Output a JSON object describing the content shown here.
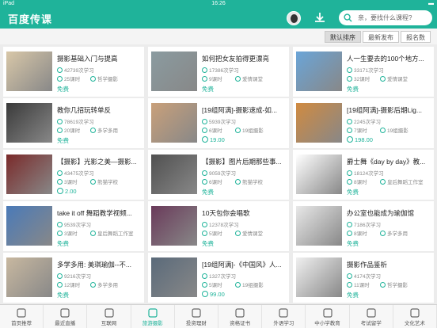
{
  "status": {
    "device": "iPad",
    "time": "16:26"
  },
  "header": {
    "logo": "百度传课",
    "search_placeholder": "亲，要找什么课程?"
  },
  "sort": [
    "默认排序",
    "最新发布",
    "报名数"
  ],
  "courses": [
    {
      "title": "摄影基础入门与提高",
      "students": "42739次学习",
      "lessons": "25课时",
      "category": "哲学摄影",
      "price": "免费",
      "paid": false
    },
    {
      "title": "如何把女友拍得更漂亮",
      "students": "17386次学习",
      "lessons": "9课时",
      "category": "爱情课堂",
      "price": "免费",
      "paid": false
    },
    {
      "title": "人一生要去的100个地方...",
      "students": "33171次学习",
      "lessons": "32课时",
      "category": "爱情课堂",
      "price": "免费",
      "paid": false
    },
    {
      "title": "教你几招玩转单反",
      "students": "78619次学习",
      "lessons": "20课时",
      "category": "多学多用",
      "price": "免费",
      "paid": false
    },
    {
      "title": "[19组阿满]-摄影速成-如...",
      "students": "5939次学习",
      "lessons": "6课时",
      "category": "19组摄影",
      "price": "19.00",
      "paid": true
    },
    {
      "title": "[19组阿满]-摄影后期Lig...",
      "students": "2245次学习",
      "lessons": "7课时",
      "category": "19组摄影",
      "price": "198.00",
      "paid": true
    },
    {
      "title": "【摄影】光影之美—摄影...",
      "students": "43475次学习",
      "lessons": "3课时",
      "category": "熊猫学校",
      "price": "2.00",
      "paid": true
    },
    {
      "title": "【摄影】图片后期那些事...",
      "students": "9059次学习",
      "lessons": "6课时",
      "category": "熊猫学校",
      "price": "免费",
      "paid": false
    },
    {
      "title": "爵士舞《day by day》教...",
      "students": "18124次学习",
      "lessons": "8课时",
      "category": "皇后舞蹈工作室",
      "price": "免费",
      "paid": false
    },
    {
      "title": "take it off 舞蹈教学视频...",
      "students": "9539次学习",
      "lessons": "3课时",
      "category": "皇后舞蹈工作室",
      "price": "免费",
      "paid": false
    },
    {
      "title": "10天包你会唱歌",
      "students": "12378次学习",
      "lessons": "5课时",
      "category": "爱情课堂",
      "price": "免费",
      "paid": false
    },
    {
      "title": "办公室也能成为瑜伽馆",
      "students": "7186次学习",
      "lessons": "8课时",
      "category": "多学多用",
      "price": "免费",
      "paid": false
    },
    {
      "title": "多学多用: 美琪瑜伽--不...",
      "students": "9216次学习",
      "lessons": "12课时",
      "category": "多学多用",
      "price": "免费",
      "paid": false
    },
    {
      "title": "[19组阿满]-《中国风》人...",
      "students": "1327次学习",
      "lessons": "5课时",
      "category": "19组摄影",
      "price": "99.00",
      "paid": true
    },
    {
      "title": "摄影作品鉴析",
      "students": "4174次学习",
      "lessons": "11课时",
      "category": "哲学摄影",
      "price": "免费",
      "paid": false
    }
  ],
  "thumb_colors": [
    "#d8c7a8",
    "#8a9ba0",
    "#6aa5d8",
    "#3a3a3a",
    "#c9a07a",
    "#d08a40",
    "#7a2a2a",
    "#505050",
    "#ffffff",
    "#4a7ab8",
    "#6a3a5a",
    "#e8e8e8",
    "#c8b8a0",
    "#5a6a7a",
    "#f0f0f0"
  ],
  "nav": [
    {
      "label": "首页推荐",
      "icon": "home-icon"
    },
    {
      "label": "最近直播",
      "icon": "video-icon"
    },
    {
      "label": "互联网",
      "icon": "globe-icon"
    },
    {
      "label": "旅游摄影",
      "icon": "camera-icon"
    },
    {
      "label": "投资理财",
      "icon": "money-icon"
    },
    {
      "label": "资格证书",
      "icon": "certificate-icon"
    },
    {
      "label": "外语学习",
      "icon": "language-icon"
    },
    {
      "label": "中小学教育",
      "icon": "book-icon"
    },
    {
      "label": "考试留学",
      "icon": "graduation-icon"
    },
    {
      "label": "文化艺术",
      "icon": "art-icon"
    }
  ],
  "nav_active": 3,
  "accent": "#1fb39a"
}
